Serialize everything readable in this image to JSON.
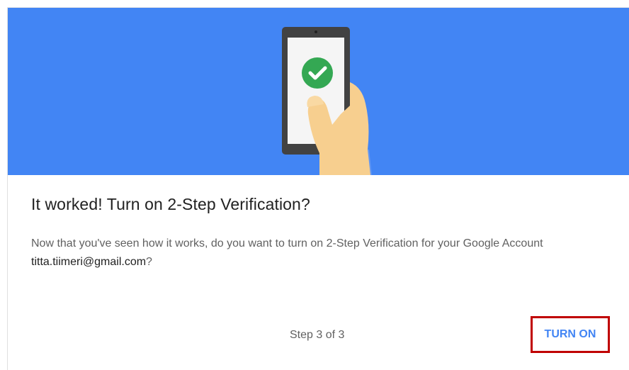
{
  "hero": {
    "background_color": "#4285f4",
    "illustration_icon": "phone-check-icon"
  },
  "content": {
    "title": "It worked! Turn on 2-Step Verification?",
    "description_prefix": "Now that you've seen how it works, do you want to turn on 2-Step Verification for your Google Account ",
    "email": "titta.tiimeri@gmail.com",
    "description_suffix": "?"
  },
  "footer": {
    "step_text": "Step 3 of 3",
    "turn_on_label": "TURN ON",
    "accent_color": "#4285f4",
    "highlight_color": "#c00000"
  }
}
